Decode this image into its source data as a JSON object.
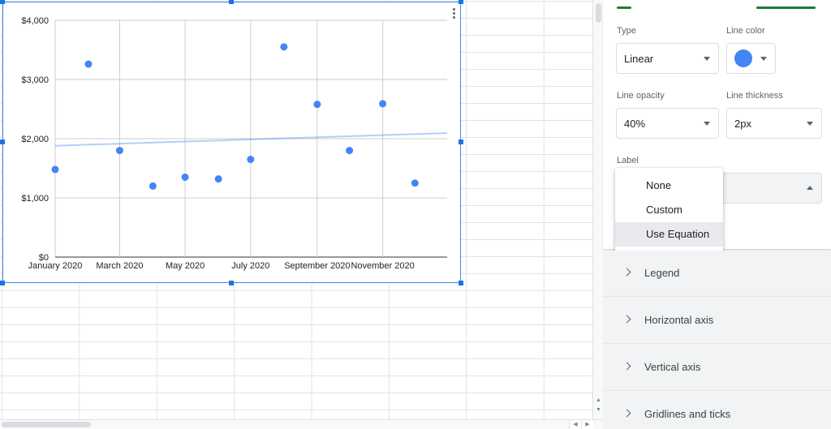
{
  "chart_data": {
    "type": "scatter",
    "title": "",
    "xlabel": "",
    "ylabel": "",
    "ylim": [
      0,
      4000
    ],
    "xlim": [
      "2020-01-01",
      "2020-12-31"
    ],
    "y_ticks": [
      "$0",
      "$1,000",
      "$2,000",
      "$3,000",
      "$4,000"
    ],
    "x_ticks": [
      "January 2020",
      "March 2020",
      "May 2020",
      "July 2020",
      "September 2020",
      "November 2020"
    ],
    "grid": true,
    "legend": "none",
    "series": [
      {
        "points": [
          {
            "x": "2020-01-01",
            "y": 1480
          },
          {
            "x": "2020-02-01",
            "y": 3260
          },
          {
            "x": "2020-03-01",
            "y": 1800
          },
          {
            "x": "2020-04-01",
            "y": 1200
          },
          {
            "x": "2020-05-01",
            "y": 1350
          },
          {
            "x": "2020-06-01",
            "y": 1320
          },
          {
            "x": "2020-07-01",
            "y": 1650
          },
          {
            "x": "2020-08-01",
            "y": 3550
          },
          {
            "x": "2020-09-01",
            "y": 2580
          },
          {
            "x": "2020-10-01",
            "y": 1800
          },
          {
            "x": "2020-11-01",
            "y": 2590
          },
          {
            "x": "2020-12-01",
            "y": 1250
          }
        ],
        "color": "#4285f4"
      }
    ],
    "trendline": {
      "type": "linear",
      "from": {
        "x": "2020-01-01",
        "y": 1880
      },
      "to": {
        "x": "2020-12-31",
        "y": 2095
      },
      "color": "#4285f4",
      "opacity": 0.4
    }
  },
  "panel": {
    "type_label": "Type",
    "type_value": "Linear",
    "line_color_label": "Line color",
    "line_color_value": "#4285f4",
    "line_opacity_label": "Line opacity",
    "line_opacity_value": "40%",
    "line_thickness_label": "Line thickness",
    "line_thickness_value": "2px",
    "label_label": "Label",
    "label_options": [
      "None",
      "Custom",
      "Use Equation"
    ],
    "label_highlighted": "Use Equation"
  },
  "sections": [
    "Legend",
    "Horizontal axis",
    "Vertical axis",
    "Gridlines and ticks"
  ],
  "colors": {
    "accent": "#1a73e8",
    "tab_underline": "#188038",
    "series": "#4285f4"
  },
  "icons": {
    "chart_menu": "kebab-vertical-icon",
    "dropdown": "caret-down-icon",
    "section_toggle": "chevron-right-icon"
  }
}
